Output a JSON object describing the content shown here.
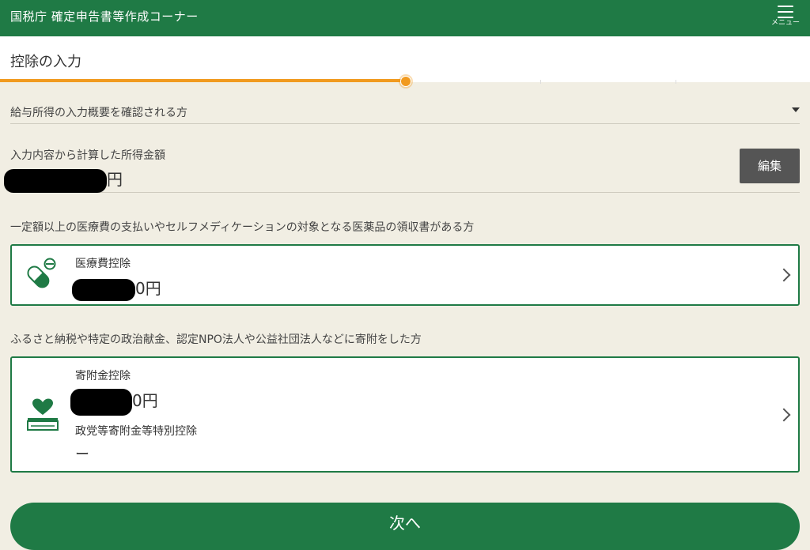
{
  "header": {
    "app_title": "国税庁 確定申告書等作成コーナー",
    "menu_label": "メニュー"
  },
  "page": {
    "title": "控除の入力"
  },
  "progress": {
    "value": 0.5,
    "color": "#f19a1f"
  },
  "accordion": {
    "label": "給与所得の入力概要を確認される方"
  },
  "income": {
    "label": "入力内容から計算した所得金額",
    "unit": "円",
    "edit_label": "編集"
  },
  "medical": {
    "note": "一定額以上の医療費の支払いやセルフメディケーションの対象となる医薬品の領収書がある方",
    "title": "医療費控除",
    "amount_suffix": "0円",
    "icon": "capsule-icon"
  },
  "donation": {
    "note": "ふるさと納税や特定の政治献金、認定NPO法人や公益社団法人などに寄附をした方",
    "title": "寄附金控除",
    "amount_suffix": "0円",
    "sub_title": "政党等寄附金等特別控除",
    "sub_value": "ー",
    "icon": "heart-box-icon"
  },
  "footer": {
    "next_label": "次へ"
  },
  "colors": {
    "brand_green": "#1f7a45",
    "background": "#f1eee3",
    "accent_orange": "#f19a1f"
  }
}
